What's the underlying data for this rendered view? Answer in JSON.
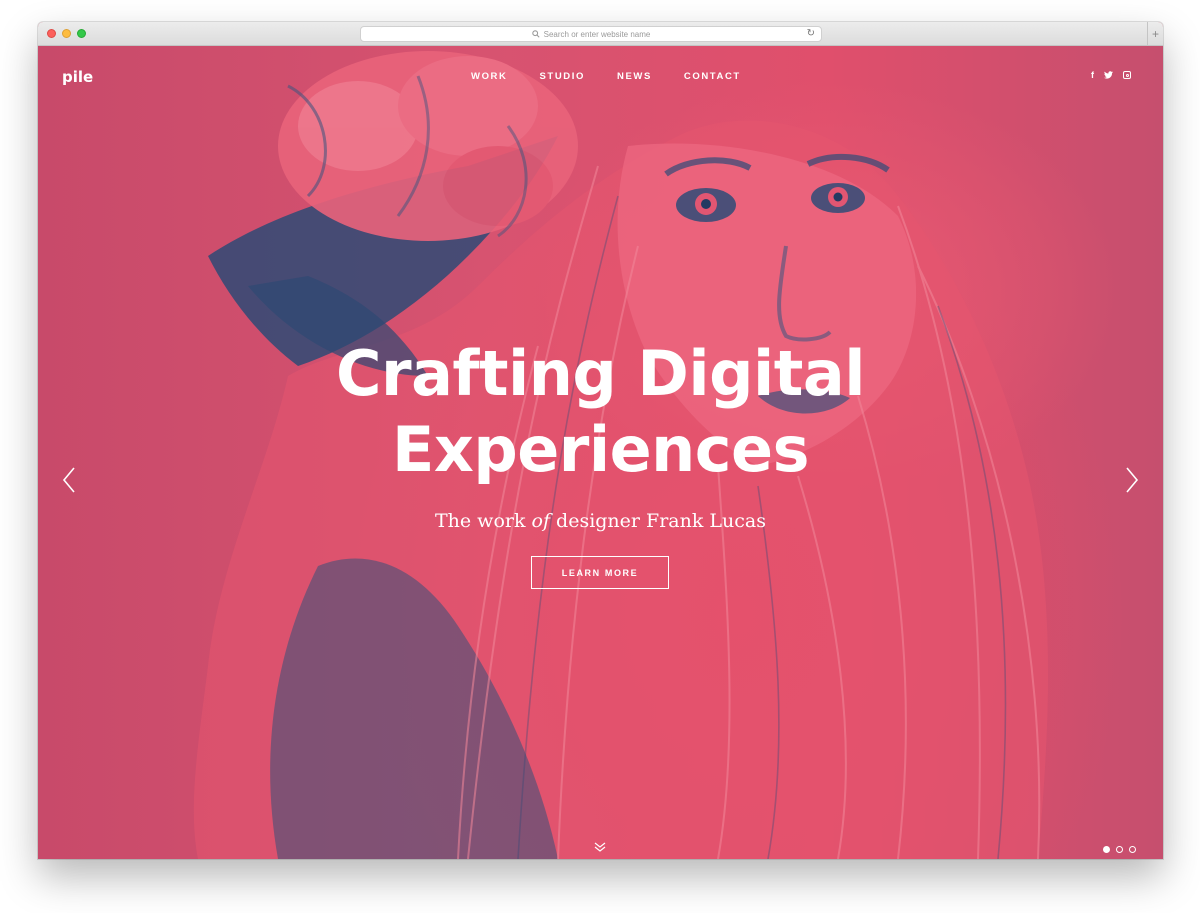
{
  "browser": {
    "url_placeholder": "Search or enter website name"
  },
  "site": {
    "logo": "pile",
    "nav": [
      "WORK",
      "STUDIO",
      "NEWS",
      "CONTACT"
    ],
    "social": {
      "facebook": "f",
      "twitter": "twitter-icon",
      "instagram": "instagram-icon"
    }
  },
  "hero": {
    "headline_line1": "Crafting Digital",
    "headline_line2": "Experiences",
    "subtitle_pre": "The work ",
    "subtitle_em": "of",
    "subtitle_post": " designer Frank Lucas",
    "cta": "LEARN MORE",
    "slides_total": 3,
    "active_slide": 1
  },
  "colors": {
    "duotone_pink": "#e04f6c",
    "duotone_navy": "#2f4d78",
    "text": "#ffffff"
  }
}
